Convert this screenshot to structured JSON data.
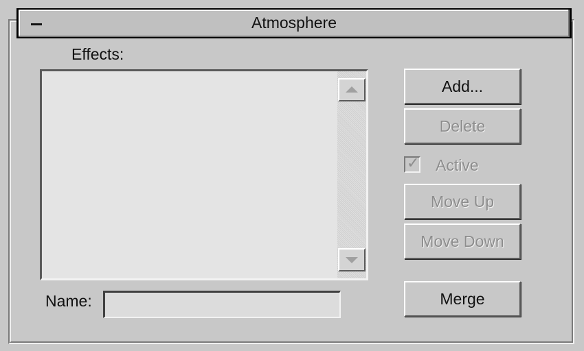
{
  "rollout": {
    "title": "Atmosphere",
    "collapse_icon": "minus-icon"
  },
  "effects": {
    "label": "Effects:",
    "items": [],
    "scroll_up_icon": "scroll-up-arrow-icon",
    "scroll_down_icon": "scroll-down-arrow-icon"
  },
  "buttons": {
    "add": "Add...",
    "delete": "Delete",
    "move_up": "Move Up",
    "move_down": "Move Down",
    "merge": "Merge"
  },
  "active": {
    "label": "Active",
    "checked": true,
    "enabled": false
  },
  "name_field": {
    "label": "Name:",
    "value": ""
  }
}
